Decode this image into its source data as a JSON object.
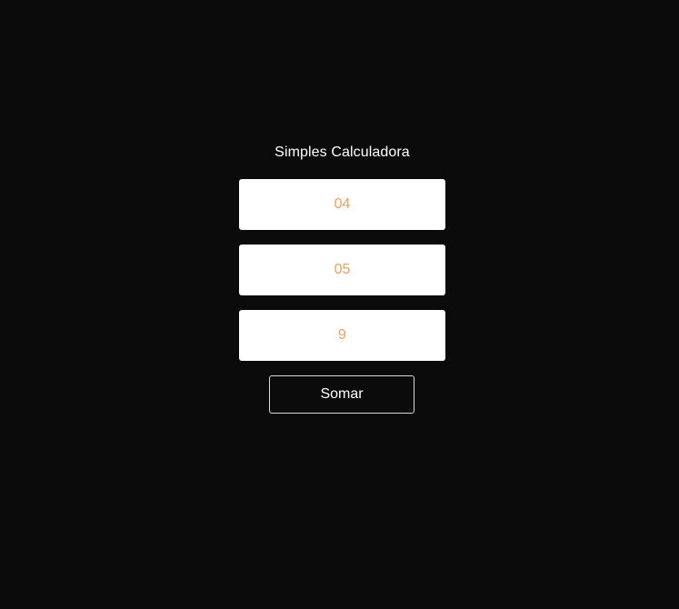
{
  "calculator": {
    "title": "Simples Calculadora",
    "first_number": "04",
    "second_number": "05",
    "result": "9",
    "sum_button_label": "Somar"
  },
  "colors": {
    "background": "#0b0b0b",
    "input_background": "#ffffff",
    "input_text": "#f0a05b",
    "title_text": "#ffffff",
    "button_border": "#d8d8d8"
  }
}
